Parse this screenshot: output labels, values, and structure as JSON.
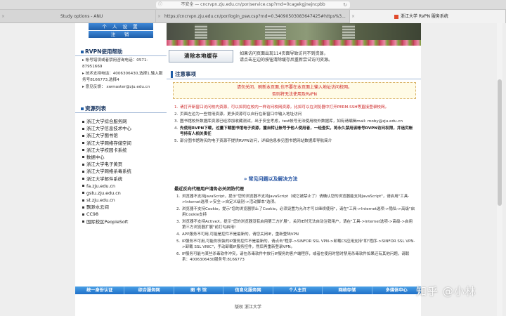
{
  "browser": {
    "url": "不安全 — cncrvpn.zju.edu.cn/por/service.csp?rnd=0cagekgjnejncpbb",
    "tabs": [
      {
        "title": "Study options - ANU"
      },
      {
        "title": "https://cncrvpn.zju.edu.cn/por/login_psw.csp?rnd=0.34090503083647425#https%3..."
      },
      {
        "title": "浙江大学 RVPN 服务系统"
      }
    ]
  },
  "sidebar": {
    "top_buttons": [
      "个 人 设 置",
      "注　销"
    ],
    "help_title": "RVPN使用帮助",
    "help_items": [
      "▸ 帐号错误或者禁用咨询电话：0571-87951669",
      "▸ 技术支持电话：4006306430,选择1,输入服务号8166773,选择4",
      "▸ 意见反馈：  xwmaster@zju.edu.cn"
    ],
    "resources_title": "资源列表",
    "resources": [
      "浙江大学综合服务网",
      "浙江大学信息技术中心",
      "浙江大学图书馆",
      "浙江大学网络存储空间",
      "浙江大学校园卡系统",
      "数据中心",
      "浙江大学电子黄页",
      "浙江大学网络杀毒系统",
      "浙江大学邮件系统",
      "fa.zju.edu.cn",
      "gstu.zju.edu.cn",
      "st.zju.edu.cn",
      "飘渺水云间",
      "CC98",
      "国际校区PeopleSoft"
    ]
  },
  "main": {
    "cache_button": "清除本地缓存",
    "cache_note_1": "如果访问页面出现114页面导致访问不到资源，",
    "cache_note_2": "请点击左边的按钮清除缓存后重新尝试访问资源。",
    "notice_title": "注意事项",
    "warn_1": "请勿关闭、刷新本页面,也不要在本页面上输入地址访问校网。",
    "warn_2": "否则将无法使用及RVPN",
    "tips": [
      {
        "num": "1.",
        "text": "请打开新窗口访问校内资源，可以如同在校内一样访问校网资源，比如可以在浏览器中打开PERM.SSH等直接登录校网。",
        "red": true
      },
      {
        "num": "2.",
        "text": "页面左边为一些常用资源，更多资源可以自行在新窗口中输入地址访问",
        "red": false
      },
      {
        "num": "3.",
        "text": "图书馆校外数据库资源已经添加收藏测试，出于安全考虑，test帐号无法使用校外数据库，如有请编辑mail: moby@zju.edu.cn",
        "red": false
      },
      {
        "num": "4.",
        "text": "先使用RVPN下载，过量下载图书馆电子资源，擅自转让帐号予他人使用者，一经查实，将永久禁用该帐号RVPN访问权限，并追究帐号持有人相关责任",
        "red": false
      },
      {
        "num": "5.",
        "text": "部分图书馆购买的电子资源不提供RVPN访问，详细信息参见图书馆网站数据库导航简介",
        "red": false
      }
    ],
    "faq_title": "常见问题以及解决方法",
    "faq_sub": "最近反向代理用户请务必关闭防代理",
    "faq": [
      {
        "num": "1.",
        "text": "浏览器不支持JavaScript，提示\"您的浏览器不支持JavaScript（或它被禁止了）请确认您的浏览器能支持JavaScript\"，请启用\"工具->Internet选项->安全->自定义级别->活动脚本\"选项。"
      },
      {
        "num": "2.",
        "text": "浏览器不支持Cookie，提示\"您的浏览器禁止了Cookie，必须设置为允许才可以继续使用\"，请在\"工具->Internet选项->隐私->高级\"启用Cookie支持"
      },
      {
        "num": "3.",
        "text": "浏览器不支持ActiveX，提示\"您的浏览器没有启用第三方扩展\"，关闭IE时无法自动注销用户，请在\"工具->Internet选项->高级->启用第三方浏览器扩展\"前打勾启用!"
      },
      {
        "num": "4.",
        "text": "APP服务不可用,可能是控件不是最新的，请您关闭IE，重新登陆VPN"
      },
      {
        "num": "5.",
        "text": "IP服务不可用,可能你安装的IP服务控件不是最新的，请点击\"程序->SINFOR SSL VPN->卸载CS应用支持\"和\"程序->SINFOR SSL VPN->卸载 SSL VNIC\"，手动卸载IP服务控件，然后再重新登录VPN。"
      },
      {
        "num": "6.",
        "text": "IP服务可能与某些杀毒软件冲突，请在杀毒软件中放行IP服务的客户端程序，或者在使用时暂时禁用杀毒软件如果还有其他问题，请联系：4006306430服务号:8166773"
      }
    ],
    "footer_links": [
      "统一身份认证",
      "综合服务网",
      "图 书 馆",
      "信息化服务网",
      "个人主页",
      "网络存储",
      "多媒体中心"
    ],
    "copyright": "版权 浙江大学"
  },
  "watermark": "知乎 @小林"
}
